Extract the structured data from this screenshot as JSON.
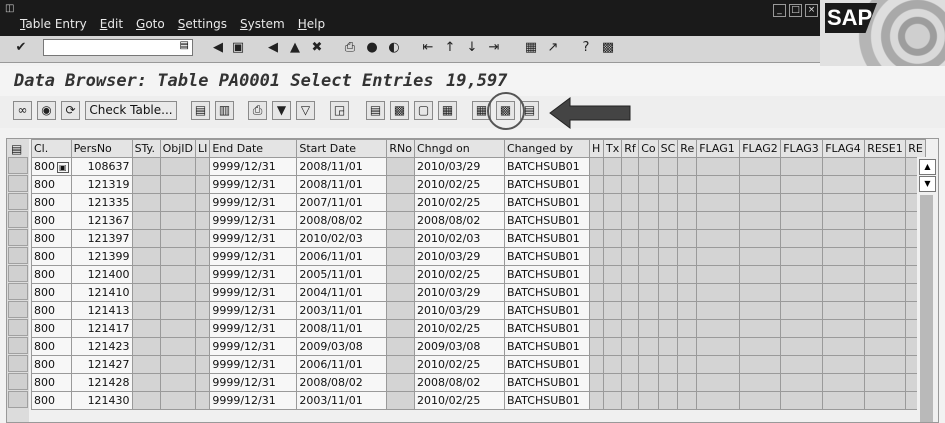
{
  "menubar": {
    "items": [
      "Table Entry",
      "Edit",
      "Goto",
      "Settings",
      "System",
      "Help"
    ],
    "logo": "SAP"
  },
  "toolbar": {
    "command_value": "",
    "icons": [
      "enter-icon",
      "save-icon",
      "back-icon",
      "exit-icon",
      "cancel-icon",
      "print-icon",
      "find-icon",
      "find-next-icon",
      "first-page-icon",
      "previous-page-icon",
      "next-page-icon",
      "last-page-icon",
      "create-session-icon",
      "shortcut-icon",
      "help-icon",
      "customize-layout-icon"
    ]
  },
  "title": {
    "text": "Data Browser: Table PA0001 Select Entries",
    "count": "19,597"
  },
  "app_toolbar": {
    "check_table_label": "Check Table..."
  },
  "table": {
    "columns": [
      "Cl.",
      "PersNo",
      "STy.",
      "ObjID",
      "LI",
      "End Date",
      "Start Date",
      "RNo",
      "Chngd on",
      "Changed by",
      "H",
      "Tx",
      "Rf",
      "Co",
      "SC",
      "Re",
      "FLAG1",
      "FLAG2",
      "FLAG3",
      "FLAG4",
      "RESE1",
      "RE"
    ],
    "rows": [
      {
        "cl": "800",
        "persno": "108637",
        "end": "9999/12/31",
        "start": "2008/11/01",
        "chngd": "2010/03/29",
        "by": "BATCHSUB01"
      },
      {
        "cl": "800",
        "persno": "121319",
        "end": "9999/12/31",
        "start": "2008/11/01",
        "chngd": "2010/02/25",
        "by": "BATCHSUB01"
      },
      {
        "cl": "800",
        "persno": "121335",
        "end": "9999/12/31",
        "start": "2007/11/01",
        "chngd": "2010/02/25",
        "by": "BATCHSUB01"
      },
      {
        "cl": "800",
        "persno": "121367",
        "end": "9999/12/31",
        "start": "2008/08/02",
        "chngd": "2008/08/02",
        "by": "BATCHSUB01"
      },
      {
        "cl": "800",
        "persno": "121397",
        "end": "9999/12/31",
        "start": "2010/02/03",
        "chngd": "2010/02/03",
        "by": "BATCHSUB01"
      },
      {
        "cl": "800",
        "persno": "121399",
        "end": "9999/12/31",
        "start": "2006/11/01",
        "chngd": "2010/03/29",
        "by": "BATCHSUB01"
      },
      {
        "cl": "800",
        "persno": "121400",
        "end": "9999/12/31",
        "start": "2005/11/01",
        "chngd": "2010/02/25",
        "by": "BATCHSUB01"
      },
      {
        "cl": "800",
        "persno": "121410",
        "end": "9999/12/31",
        "start": "2004/11/01",
        "chngd": "2010/03/29",
        "by": "BATCHSUB01"
      },
      {
        "cl": "800",
        "persno": "121413",
        "end": "9999/12/31",
        "start": "2003/11/01",
        "chngd": "2010/03/29",
        "by": "BATCHSUB01"
      },
      {
        "cl": "800",
        "persno": "121417",
        "end": "9999/12/31",
        "start": "2008/11/01",
        "chngd": "2010/02/25",
        "by": "BATCHSUB01"
      },
      {
        "cl": "800",
        "persno": "121423",
        "end": "9999/12/31",
        "start": "2009/03/08",
        "chngd": "2009/03/08",
        "by": "BATCHSUB01"
      },
      {
        "cl": "800",
        "persno": "121427",
        "end": "9999/12/31",
        "start": "2006/11/01",
        "chngd": "2010/02/25",
        "by": "BATCHSUB01"
      },
      {
        "cl": "800",
        "persno": "121428",
        "end": "9999/12/31",
        "start": "2008/08/02",
        "chngd": "2008/08/02",
        "by": "BATCHSUB01"
      },
      {
        "cl": "800",
        "persno": "121430",
        "end": "9999/12/31",
        "start": "2003/11/01",
        "chngd": "2010/02/25",
        "by": "BATCHSUB01"
      }
    ]
  }
}
